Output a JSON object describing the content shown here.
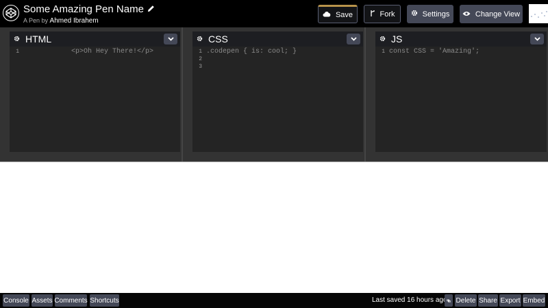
{
  "header": {
    "pen_title": "Some Amazing Pen Name",
    "byline_prefix": "A Pen by",
    "author": "Ahmed Ibrahem",
    "buttons": {
      "save": "Save",
      "fork": "Fork",
      "settings": "Settings",
      "change_view": "Change View"
    }
  },
  "editors": [
    {
      "lang": "HTML",
      "lines": [
        "1"
      ],
      "code": "<p>Oh Hey There!</p>"
    },
    {
      "lang": "CSS",
      "lines": [
        "1",
        "2",
        "3"
      ],
      "code": ".codepen { is: cool; }"
    },
    {
      "lang": "JS",
      "lines": [
        "1"
      ],
      "code": "const CSS = 'Amazing';"
    }
  ],
  "footer": {
    "left": [
      "Console",
      "Assets",
      "Comments",
      "Shortcuts"
    ],
    "saved": "Last saved 16 hours ago",
    "right": [
      "Delete",
      "Share",
      "Export",
      "Embed"
    ]
  }
}
